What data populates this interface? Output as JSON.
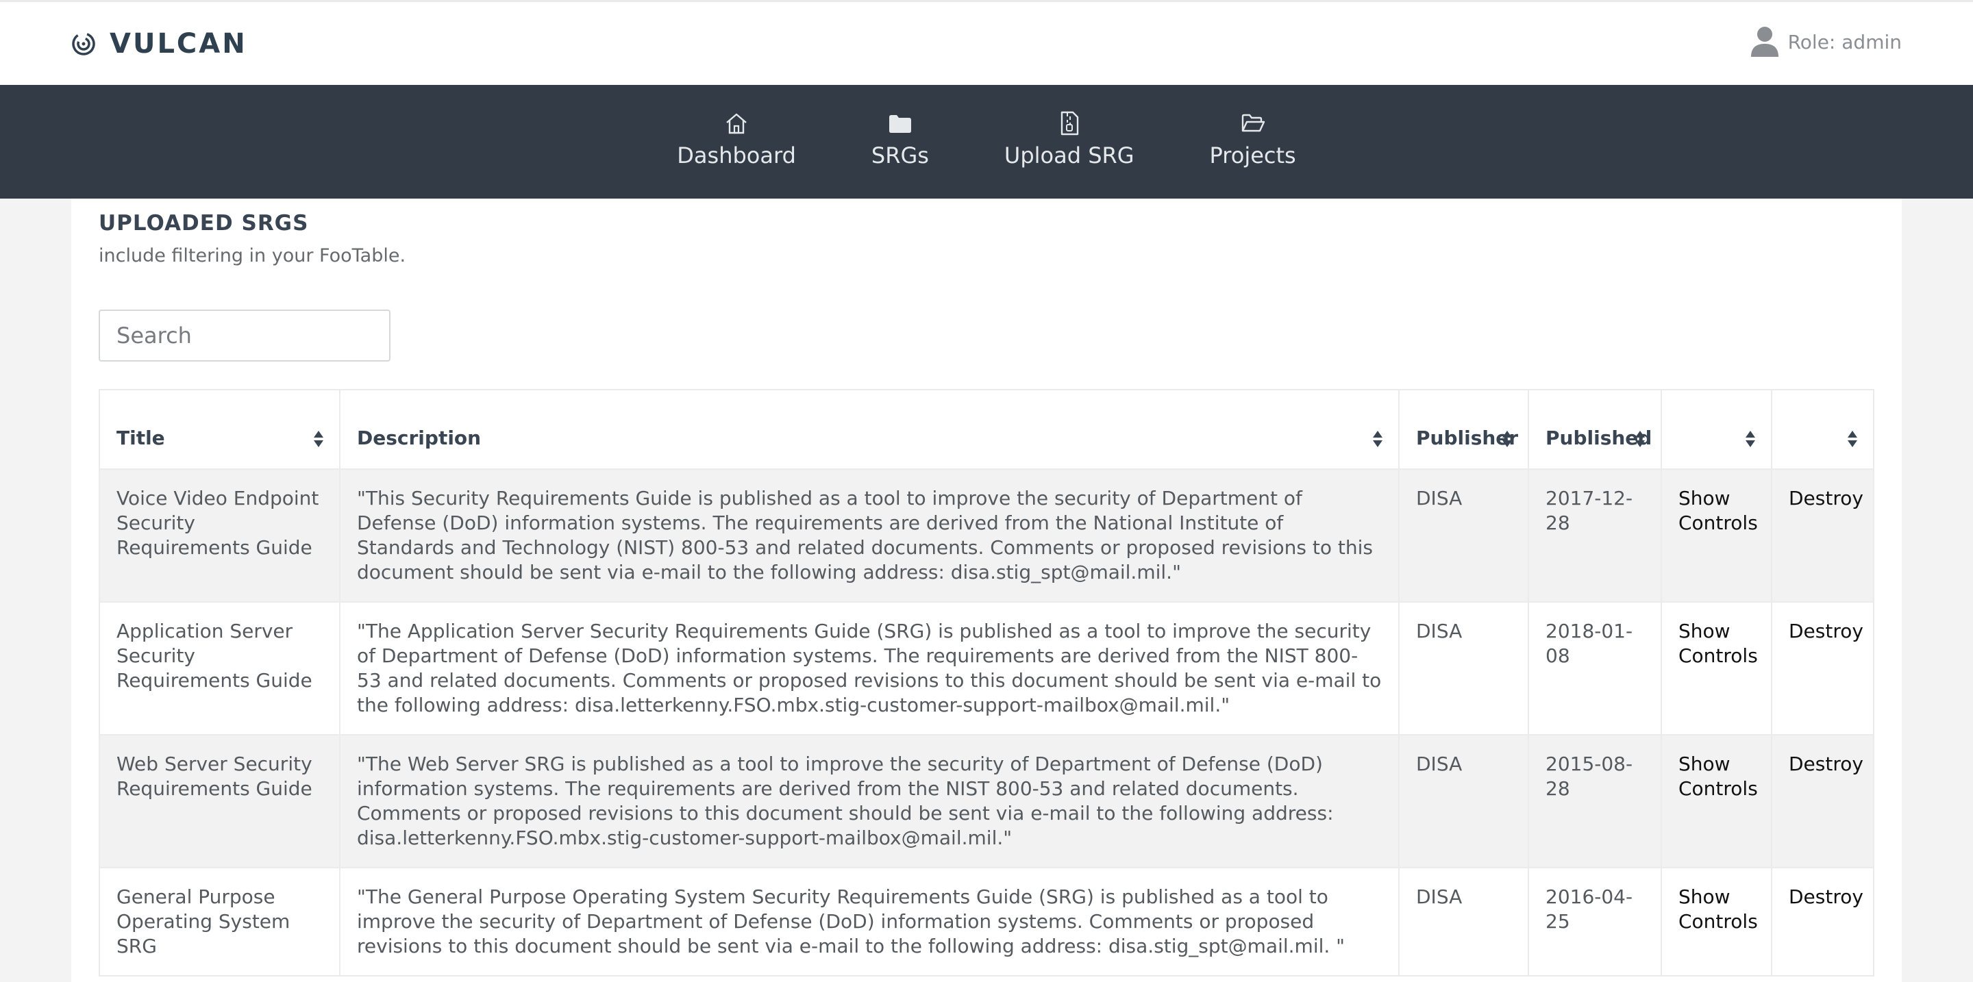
{
  "app": {
    "name": "VULCAN",
    "role_label": "Role: admin"
  },
  "nav": {
    "items": [
      {
        "label": "Dashboard",
        "icon": "home-icon"
      },
      {
        "label": "SRGs",
        "icon": "folder-icon"
      },
      {
        "label": "Upload SRG",
        "icon": "file-upload-icon"
      },
      {
        "label": "Projects",
        "icon": "folder-open-icon"
      }
    ]
  },
  "panel": {
    "title": "UPLOADED SRGS",
    "subtitle": "include filtering in your FooTable."
  },
  "search": {
    "placeholder": "Search",
    "value": ""
  },
  "table": {
    "headers": [
      "Title",
      "Description",
      "Publisher",
      "Published",
      "",
      ""
    ],
    "rows": [
      {
        "title": "Voice Video Endpoint Security Requirements Guide",
        "description": "\"This Security Requirements Guide is published as a tool to improve the security of Department of Defense (DoD) information systems. The requirements are derived from the National Institute of Standards and Technology (NIST) 800-53 and related documents. Comments or proposed revisions to this document should be sent via e-mail to the following address: disa.stig_spt@mail.mil.\"",
        "publisher": "DISA",
        "published": "2017-12-28",
        "show": "Show Controls",
        "destroy": "Destroy"
      },
      {
        "title": "Application Server Security Requirements Guide",
        "description": "\"The Application Server Security Requirements Guide (SRG) is published as a tool to improve the security of Department of Defense (DoD) information systems. The requirements are derived from the NIST 800-53 and related documents. Comments or proposed revisions to this document should be sent via e-mail to the following address: disa.letterkenny.FSO.mbx.stig-customer-support-mailbox@mail.mil.\"",
        "publisher": "DISA",
        "published": "2018-01-08",
        "show": "Show Controls",
        "destroy": "Destroy"
      },
      {
        "title": "Web Server Security Requirements Guide",
        "description": "\"The Web Server SRG is published as a tool to improve the security of Department of Defense (DoD) information systems. The requirements are derived from the NIST 800-53 and related documents. Comments or proposed revisions to this document should be sent via e-mail to the following address: disa.letterkenny.FSO.mbx.stig-customer-support-mailbox@mail.mil.\"",
        "publisher": "DISA",
        "published": "2015-08-28",
        "show": "Show Controls",
        "destroy": "Destroy"
      },
      {
        "title": "General Purpose Operating System SRG",
        "description": "\"The General Purpose Operating System Security Requirements Guide (SRG) is published as a tool to improve the security of Department of Defense (DoD) information systems. Comments or proposed revisions to this document should be sent via e-mail to the following address: disa.stig_spt@mail.mil. \"",
        "publisher": "DISA",
        "published": "2016-04-25",
        "show": "Show Controls",
        "destroy": "Destroy"
      }
    ]
  },
  "colors": {
    "navbar": "#323b46",
    "header_text": "#3a4553",
    "row_stripe": "#f2f2f2",
    "page_bg": "#f3f3f4"
  }
}
